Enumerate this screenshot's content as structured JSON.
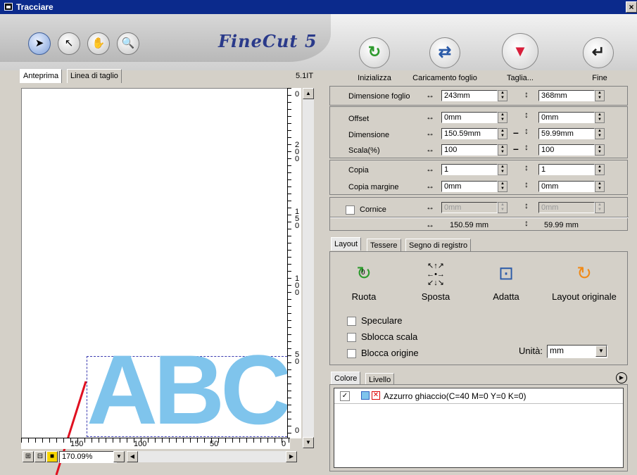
{
  "window": {
    "title": "Tracciare",
    "close": "×"
  },
  "toolbar": {
    "tools": [
      {
        "name": "select-arrow-icon",
        "glyph": "➤"
      },
      {
        "name": "direct-select-icon",
        "glyph": "↖"
      },
      {
        "name": "hand-icon",
        "glyph": "✋"
      },
      {
        "name": "zoom-icon",
        "glyph": "🔍"
      }
    ],
    "logo": "FineCut 5",
    "actions": [
      {
        "label": "Inizializza",
        "glyph": "↻",
        "color": "#2e9a2e"
      },
      {
        "label": "Caricamento foglio",
        "glyph": "⇄",
        "color": "#2a5aa8"
      },
      {
        "label": "Taglia...",
        "glyph": "▼",
        "color": "#d81e3a"
      },
      {
        "label": "Fine",
        "glyph": "↵",
        "color": "#222222"
      }
    ]
  },
  "preview": {
    "tabs": [
      "Anteprima",
      "Linea di taglio"
    ],
    "version": "5.1IT",
    "artwork_text": "ABC",
    "artwork_color": "#7fc4ec",
    "ruler_v_labels": [
      "0",
      "200",
      "150",
      "100",
      "50",
      "0"
    ],
    "ruler_h_labels": [
      "150",
      "100",
      "50",
      "0"
    ],
    "zoom": "170.09%"
  },
  "sheet": {
    "label": "Dimensione foglio",
    "width": "243mm",
    "height": "368mm"
  },
  "geometry": {
    "offset_label": "Offset",
    "offset_x": "0mm",
    "offset_y": "0mm",
    "size_label": "Dimensione",
    "size_x": "150.59mm",
    "size_y": "59.99mm",
    "scale_label": "Scala(%)",
    "scale_x": "100",
    "scale_y": "100"
  },
  "copies": {
    "copy_label": "Copia",
    "copy_x": "1",
    "copy_y": "1",
    "margin_label": "Copia margine",
    "margin_x": "0mm",
    "margin_y": "0mm"
  },
  "frame": {
    "label": "Cornice",
    "frame_x": "0mm",
    "frame_y": "0mm",
    "total_x": "150.59 mm",
    "total_y": "59.99 mm"
  },
  "layout": {
    "tabs": [
      "Layout",
      "Tessere",
      "Segno di registro"
    ],
    "buttons": [
      "Ruota",
      "Sposta",
      "Adatta",
      "Layout originale"
    ],
    "rotate_value": "0",
    "checks": [
      "Speculare",
      "Sblocca scala",
      "Blocca origine"
    ],
    "unit_label": "Unità:",
    "unit_value": "mm"
  },
  "colors": {
    "tabs": [
      "Colore",
      "Livello"
    ],
    "items": [
      {
        "label": "Azzurro ghiaccio(C=40 M=0 Y=0 K=0)",
        "checked": true
      }
    ]
  }
}
